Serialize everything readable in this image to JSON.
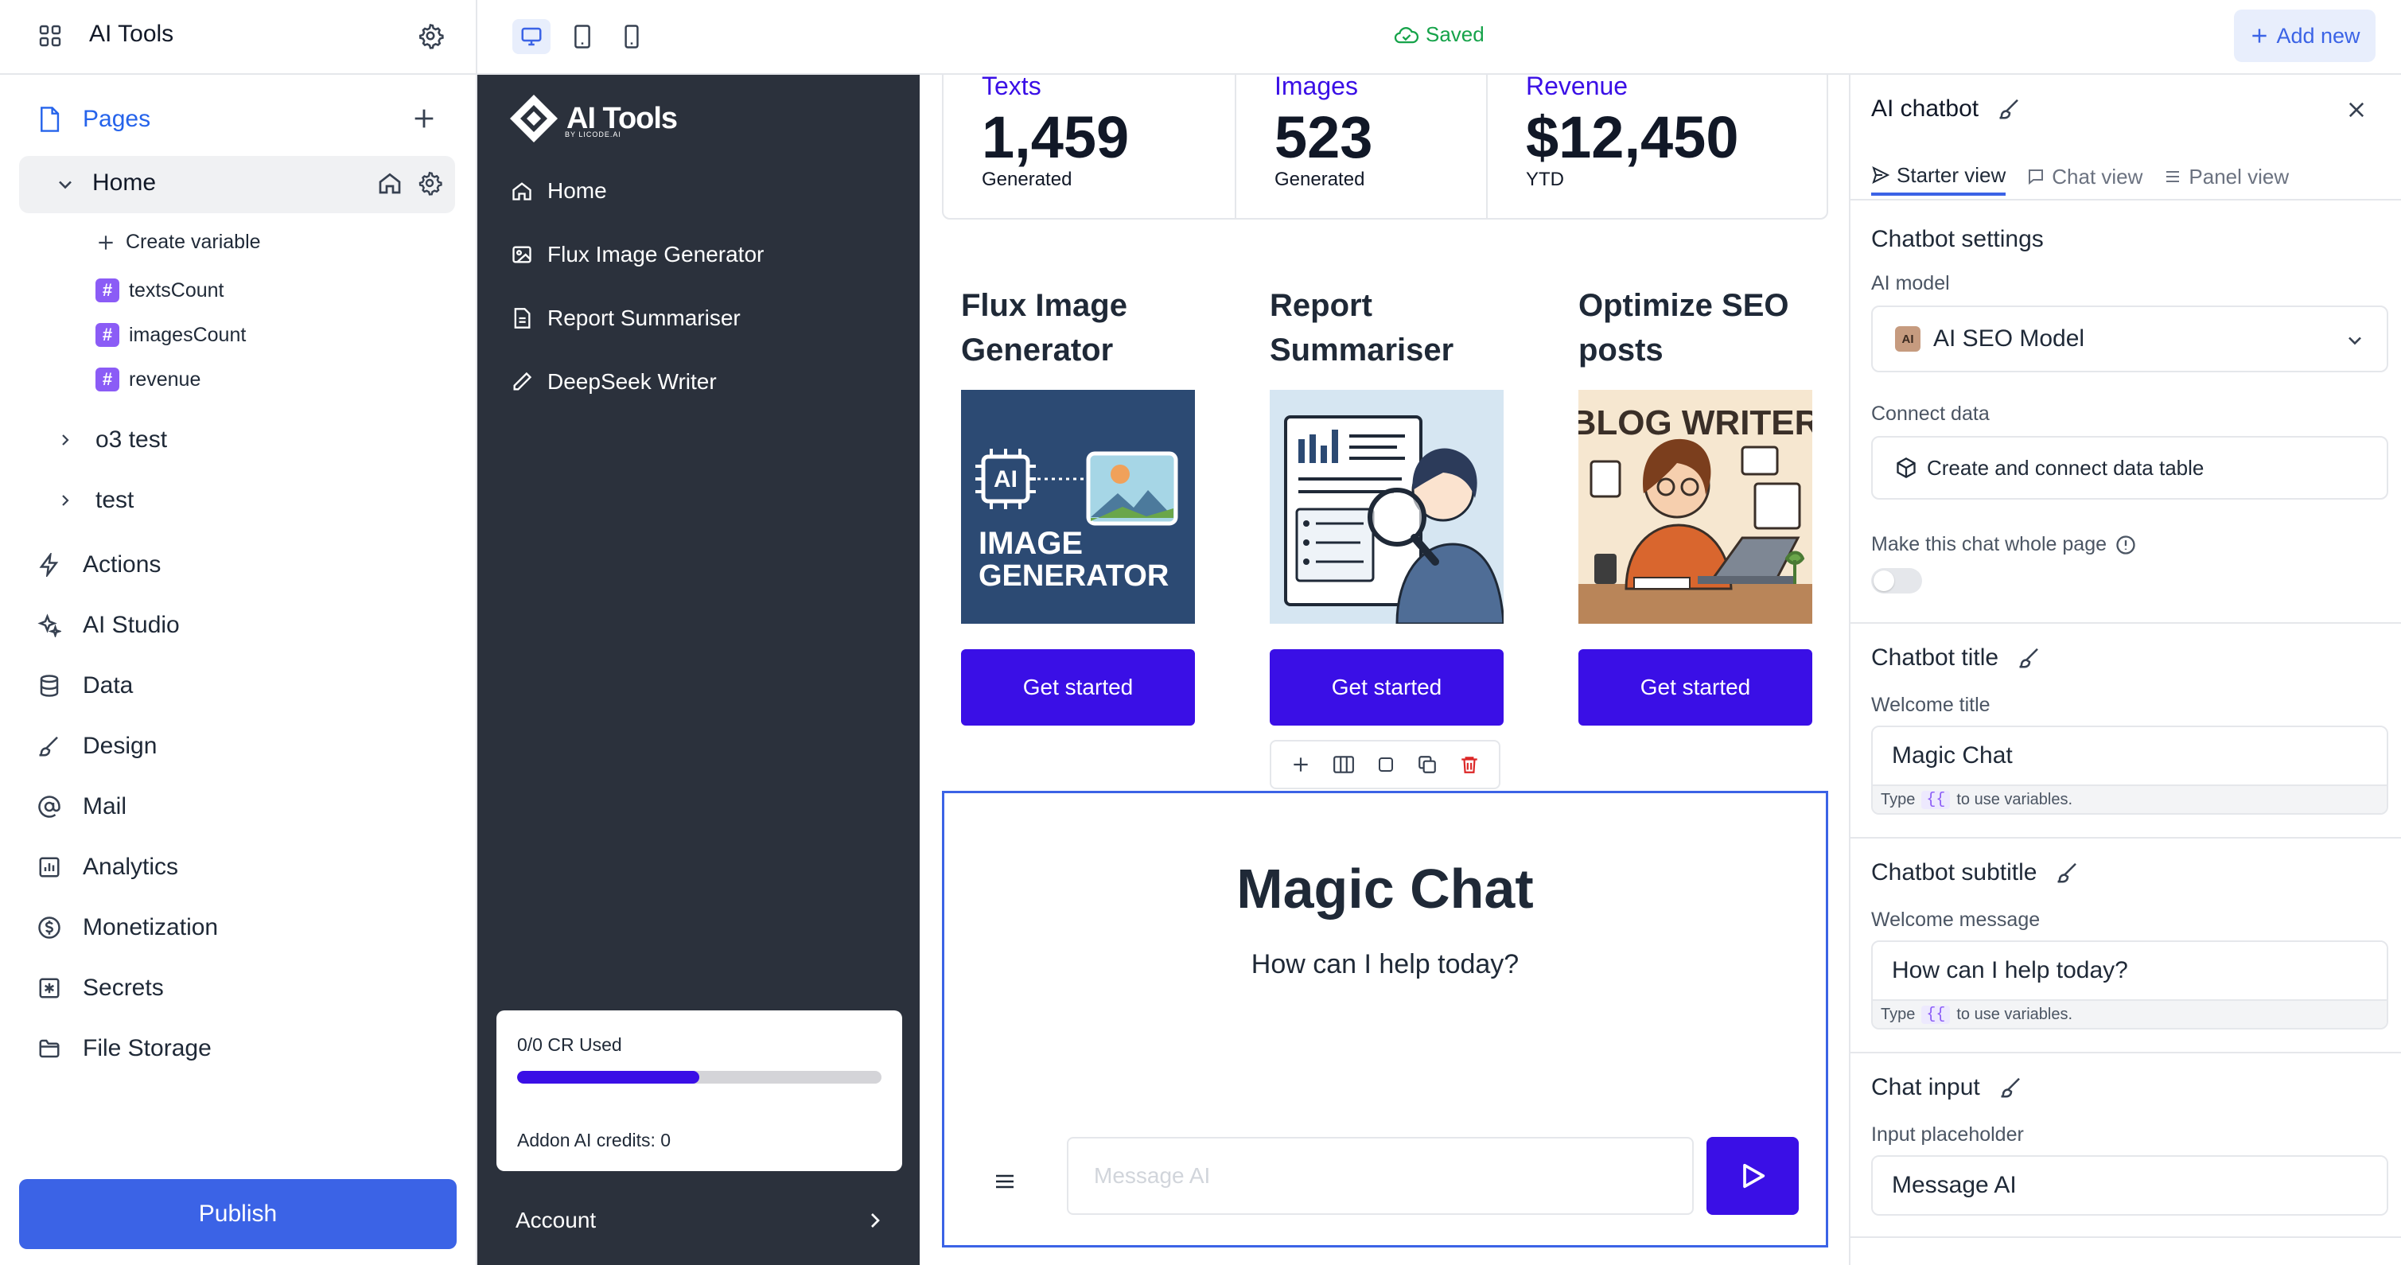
{
  "editor": {
    "app_title": "AI Tools",
    "pages_label": "Pages",
    "home_label": "Home",
    "create_variable": "Create variable",
    "variables": [
      "textsCount",
      "imagesCount",
      "revenue"
    ],
    "other_pages": [
      "o3 test",
      "test"
    ],
    "nav": [
      {
        "label": "Actions",
        "icon": "bolt-icon"
      },
      {
        "label": "AI Studio",
        "icon": "sparkles-icon"
      },
      {
        "label": "Data",
        "icon": "database-icon"
      },
      {
        "label": "Design",
        "icon": "brush-icon"
      },
      {
        "label": "Mail",
        "icon": "at-icon"
      },
      {
        "label": "Analytics",
        "icon": "chart-icon"
      },
      {
        "label": "Monetization",
        "icon": "dollar-icon"
      },
      {
        "label": "Secrets",
        "icon": "asterisk-icon"
      },
      {
        "label": "File Storage",
        "icon": "folder-icon"
      }
    ],
    "publish": "Publish"
  },
  "topbar": {
    "status": "Saved",
    "add_new": "Add new"
  },
  "preview": {
    "logo_name": "AI Tools",
    "logo_by": "BY LICODE.AI",
    "nav": [
      "Home",
      "Flux Image Generator",
      "Report Summariser",
      "DeepSeek Writer"
    ],
    "credits": {
      "used": "0/0 CR Used",
      "progress_fraction": 0.5,
      "addon": "Addon AI credits:  0"
    },
    "account": "Account",
    "stats": [
      {
        "label": "Texts",
        "value": "1,459",
        "sub": "Generated"
      },
      {
        "label": "Images",
        "value": "523",
        "sub": "Generated"
      },
      {
        "label": "Revenue",
        "value": "$12,450",
        "sub": "YTD"
      }
    ],
    "cards": [
      {
        "title": "Flux Image Generator",
        "image_text": [
          "AI",
          "IMAGE",
          "GENERATOR"
        ],
        "button": "Get started"
      },
      {
        "title": "Report Summariser",
        "button": "Get started"
      },
      {
        "title": "Optimize SEO posts",
        "image_text": [
          "BLOG WRITER"
        ],
        "button": "Get started"
      }
    ],
    "chat": {
      "title": "Magic Chat",
      "subtitle": "How can I help today?",
      "placeholder": "Message AI"
    }
  },
  "panel": {
    "title": "AI chatbot",
    "tabs": [
      "Starter view",
      "Chat view",
      "Panel view"
    ],
    "settings_heading": "Chatbot settings",
    "ai_model_label": "AI model",
    "ai_model_value": "AI SEO Model",
    "ai_model_badge": "AI",
    "connect_label": "Connect data",
    "connect_button": "Create and connect data table",
    "whole_page_label": "Make this chat whole page",
    "whole_page_enabled": false,
    "title_heading": "Chatbot title",
    "welcome_title_label": "Welcome title",
    "welcome_title_value": "Magic Chat",
    "subtitle_heading": "Chatbot subtitle",
    "welcome_message_label": "Welcome message",
    "welcome_message_value": "How can I help today?",
    "hint_type": "Type",
    "hint_braces": "{{",
    "hint_rest": "to use variables.",
    "input_heading": "Chat input",
    "placeholder_label": "Input placeholder",
    "placeholder_value": "Message AI"
  },
  "colors": {
    "accent": "#3b63e6",
    "primary_button": "#3a0fe6",
    "sidebar_dark": "#2b313c",
    "saved_green": "#16a34a",
    "variable_purple": "#8b5cf6"
  }
}
